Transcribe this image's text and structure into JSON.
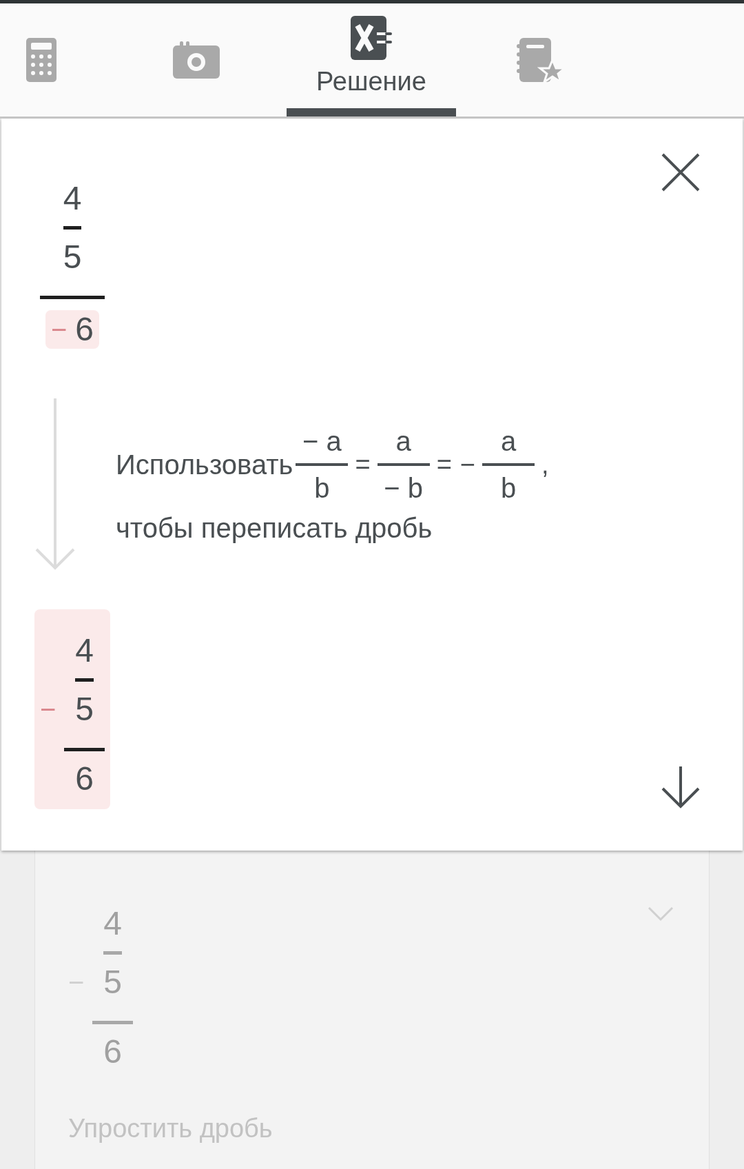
{
  "tabs": [
    {
      "kind": "calculator",
      "selected": false
    },
    {
      "kind": "camera",
      "selected": false
    },
    {
      "kind": "solve",
      "label": "Решение",
      "selected": true
    },
    {
      "kind": "notebook",
      "selected": false
    }
  ],
  "current_step": {
    "before": {
      "num": {
        "num": "4",
        "den": "5"
      },
      "den": {
        "sign": "−",
        "value": "6",
        "highlight": true
      }
    },
    "rule": {
      "lead": "Использовать",
      "formula": [
        {
          "num": "− a",
          "den": "b"
        },
        "=",
        {
          "num": "a",
          "den": "− b"
        },
        "=",
        "−",
        {
          "num": "a",
          "den": "b"
        },
        ","
      ],
      "tail": "чтобы переписать дробь"
    },
    "after": {
      "sign": "−",
      "highlight": true,
      "num": {
        "num": "4",
        "den": "5"
      },
      "den": "6"
    }
  },
  "next_step": {
    "expression": {
      "sign": "−",
      "num": {
        "num": "4",
        "den": "5"
      },
      "den": "6"
    },
    "caption": "Упростить дробь",
    "expanded": false
  }
}
